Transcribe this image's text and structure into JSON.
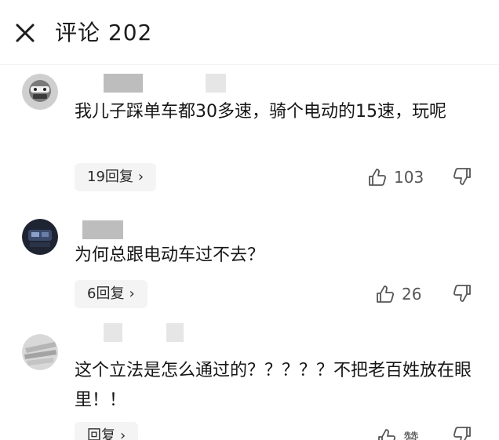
{
  "header": {
    "title": "评论 202"
  },
  "comments": [
    {
      "text": "我儿子踩单车都30多速，骑个电动的15速，玩呢",
      "replies": "19回复",
      "likes": "103"
    },
    {
      "text": "为何总跟电动车过不去？",
      "replies": "6回复",
      "likes": "26"
    },
    {
      "text": "这个立法是怎么通过的？？？？？不把老百姓放在眼里！！",
      "replies": "回复",
      "likes": "赞"
    }
  ],
  "icons": {
    "close": "close-icon",
    "reply_chevron": "chevron-right-icon",
    "like": "thumbs-up-icon",
    "dislike": "thumbs-down-icon"
  },
  "colors": {
    "text": "#161616",
    "chip_bg": "#f4f4f4",
    "icon": "#555555"
  }
}
